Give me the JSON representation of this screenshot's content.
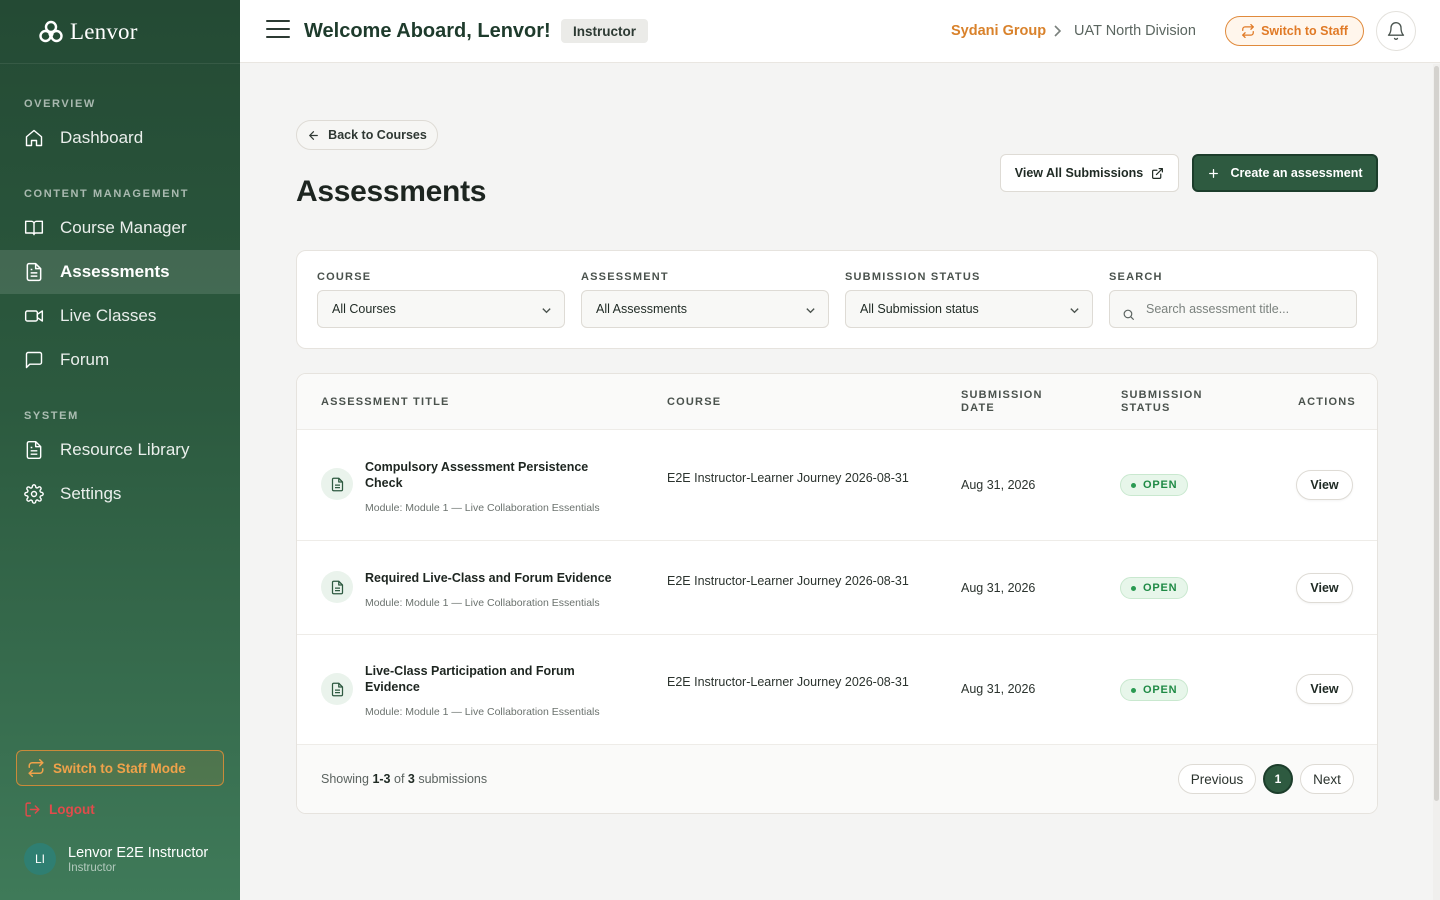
{
  "brand": {
    "name": "Lenvor"
  },
  "sidebar": {
    "sections": {
      "overview": "OVERVIEW",
      "content": "CONTENT MANAGEMENT",
      "system": "SYSTEM"
    },
    "items": [
      {
        "label": "Dashboard",
        "icon": "home-icon"
      },
      {
        "label": "Course Manager",
        "icon": "book-icon"
      },
      {
        "label": "Assessments",
        "icon": "document-icon",
        "active": true
      },
      {
        "label": "Live Classes",
        "icon": "video-icon"
      },
      {
        "label": "Forum",
        "icon": "chat-icon"
      },
      {
        "label": "Resource Library",
        "icon": "file-icon"
      },
      {
        "label": "Settings",
        "icon": "gear-icon"
      }
    ],
    "switch_mode": "Switch to Staff Mode",
    "logout": "Logout",
    "user": {
      "initials": "LI",
      "name": "Lenvor E2E Instructor",
      "role": "Instructor"
    }
  },
  "header": {
    "welcome": "Welcome Aboard, Lenvor!",
    "role_badge": "Instructor",
    "org": "Sydani Group",
    "division": "UAT North Division",
    "switch_button": "Switch to Staff"
  },
  "main": {
    "back_label": "Back to Courses",
    "title": "Assessments",
    "view_all_label": "View All Submissions",
    "create_label": "Create an assessment",
    "filters": {
      "course": {
        "label": "COURSE",
        "value": "All Courses"
      },
      "assessment": {
        "label": "ASSESSMENT",
        "value": "All Assessments"
      },
      "status": {
        "label": "SUBMISSION STATUS",
        "value": "All Submission status"
      },
      "search": {
        "label": "SEARCH",
        "placeholder": "Search assessment title..."
      }
    },
    "table": {
      "headers": {
        "title": "ASSESSMENT TITLE",
        "course": "COURSE",
        "date_1": "SUBMISSION",
        "date_2": "DATE",
        "status_1": "SUBMISSION",
        "status_2": "STATUS",
        "actions": "ACTIONS"
      },
      "rows": [
        {
          "title": "Compulsory Assessment Persistence Check",
          "module": "Module: Module 1 — Live Collaboration Essentials",
          "course": "E2E Instructor-Learner Journey 2026-08-31",
          "date": "Aug 31, 2026",
          "status": "OPEN",
          "action": "View"
        },
        {
          "title": "Required Live-Class and Forum Evidence",
          "module": "Module: Module 1 — Live Collaboration Essentials",
          "course": "E2E Instructor-Learner Journey 2026-08-31",
          "date": "Aug 31, 2026",
          "status": "OPEN",
          "action": "View"
        },
        {
          "title": "Live-Class Participation and Forum Evidence",
          "module": "Module: Module 1 — Live Collaboration Essentials",
          "course": "E2E Instructor-Learner Journey 2026-08-31",
          "date": "Aug 31, 2026",
          "status": "OPEN",
          "action": "View"
        }
      ]
    },
    "pagination": {
      "showing_prefix": "Showing",
      "range": "1-3",
      "of": "of",
      "total": "3",
      "suffix": "submissions",
      "previous": "Previous",
      "page": "1",
      "next": "Next"
    }
  },
  "colors": {
    "sidebar_top": "#244a34",
    "sidebar_bottom": "#3f7a59",
    "primary": "#2e5a40",
    "accent_orange": "#e07a26",
    "status_open": "#1f8a45",
    "logout_red": "#e14b4b"
  }
}
